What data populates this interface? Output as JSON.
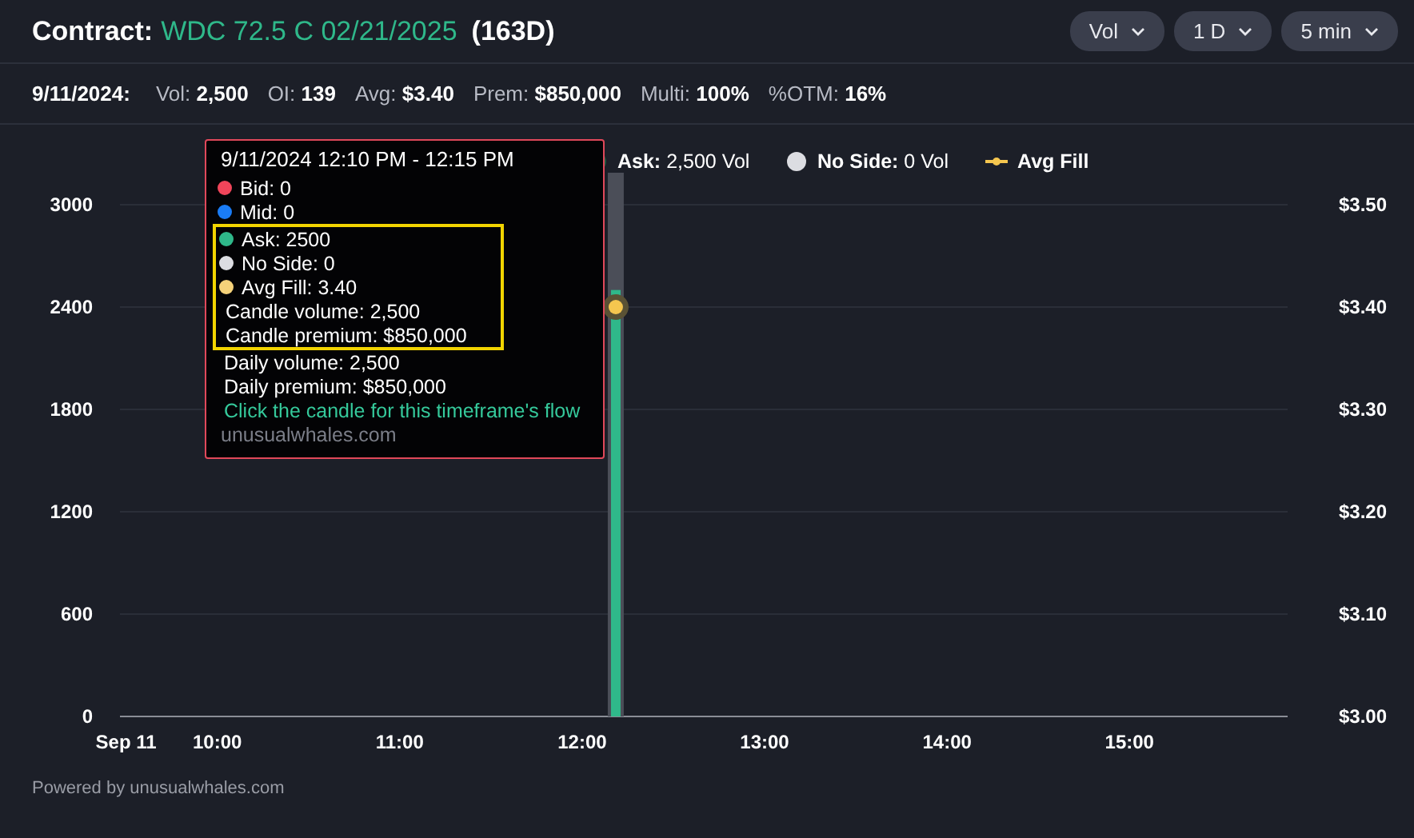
{
  "header": {
    "label": "Contract:",
    "contract": "WDC 72.5 C 02/21/2025",
    "days": "(163D)",
    "dropdowns": [
      "Vol",
      "1 D",
      "5 min"
    ]
  },
  "stats": {
    "date": "9/11/2024:",
    "items": [
      {
        "label": "Vol:",
        "value": "2,500"
      },
      {
        "label": "OI:",
        "value": "139"
      },
      {
        "label": "Avg:",
        "value": "$3.40"
      },
      {
        "label": "Prem:",
        "value": "$850,000"
      },
      {
        "label": "Multi:",
        "value": "100%"
      },
      {
        "label": "%OTM:",
        "value": "16%"
      }
    ]
  },
  "legend": [
    {
      "kind": "series",
      "value": "2,500 Vol",
      "color": "#1f5a40"
    },
    {
      "kind": "dot",
      "label": "No Side:",
      "value": "0 Vol",
      "color": "#dcdde2"
    },
    {
      "kind": "series_line",
      "color": "#f5c64f"
    }
  ],
  "chart_data": {
    "type": "bar",
    "grid": true,
    "xlim": [
      568,
      952
    ],
    "ylim": [
      0,
      3000
    ],
    "xticks": [
      {
        "value": 570,
        "label": "Sep 11"
      },
      {
        "value": 600,
        "label": "10:00"
      },
      {
        "value": 660,
        "label": "11:00"
      },
      {
        "value": 720,
        "label": "12:00"
      },
      {
        "value": 780,
        "label": "13:00"
      },
      {
        "value": 840,
        "label": "14:00"
      },
      {
        "value": 900,
        "label": "15:00"
      }
    ],
    "yticks": [
      0,
      600,
      1200,
      1800,
      2400,
      3000
    ],
    "x": [
      730
    ],
    "series": [
      {
        "name": "Ask:",
        "color": "#2fb88a",
        "values": [
          2500
        ]
      },
      {
        "name": "Avg Fill",
        "color": "#f5c64f",
        "values": [
          3.4
        ],
        "axis": "y2",
        "type": "scatter"
      }
    ],
    "y2lim": [
      3.0,
      3.5
    ],
    "y2ticks": [
      {
        "value": 3.5,
        "label": "$3.50"
      },
      {
        "value": 3.4,
        "label": "$3.40"
      },
      {
        "value": 3.3,
        "label": "$3.30"
      },
      {
        "value": 3.2,
        "label": "$3.20"
      },
      {
        "value": 3.1,
        "label": "$3.10"
      },
      {
        "value": 3.0,
        "label": "$3.00"
      }
    ]
  },
  "tooltip": {
    "title": "9/11/2024 12:10 PM - 12:15 PM",
    "rows": [
      {
        "kind": "dot",
        "text": "Bid: 0",
        "color": "#f0455a",
        "highlighted": false
      },
      {
        "kind": "dot",
        "text": "Mid: 0",
        "color": "#1a7cf5",
        "highlighted": false
      },
      {
        "kind": "dot",
        "text": "Ask: 2500",
        "color": "#2fb88a",
        "highlighted": true
      },
      {
        "kind": "dot",
        "text": "No Side: 0",
        "color": "#dcdde2",
        "highlighted": true
      },
      {
        "kind": "dot",
        "text": "Avg Fill: 3.40",
        "color": "#f5d27a",
        "highlighted": true
      },
      {
        "kind": "text",
        "text": "Candle volume: 2,500",
        "highlighted": true
      },
      {
        "kind": "text",
        "text": "Candle premium: $850,000",
        "highlighted": true
      },
      {
        "kind": "text",
        "text": "Daily volume: 2,500",
        "highlighted": false
      },
      {
        "kind": "text",
        "text": "Daily premium: $850,000",
        "highlighted": false
      },
      {
        "kind": "link",
        "text": "Click the candle for this timeframe's flow",
        "highlighted": false
      },
      {
        "kind": "brand",
        "text": "unusualwhales.com",
        "highlighted": false
      }
    ]
  },
  "footer": "Powered by unusualwhales.com"
}
